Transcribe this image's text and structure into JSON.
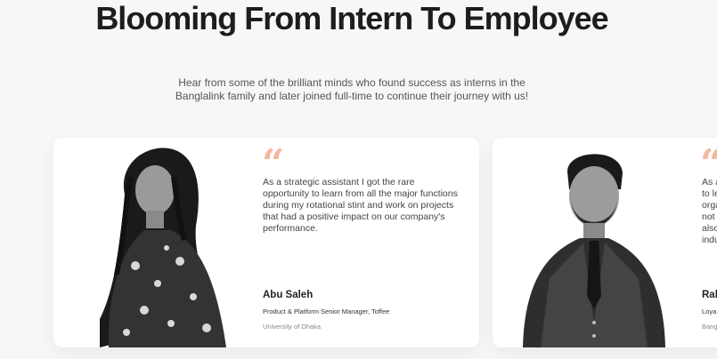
{
  "header": {
    "title": "Blooming From Intern To Employee",
    "subtitle_line1": "Hear from some of the brilliant minds who found success as interns in the",
    "subtitle_line2": "Banglalink family and later joined full-time to continue their journey with us!"
  },
  "testimonials": [
    {
      "quote_mark": "“",
      "quote": "As a strategic assistant I got the rare opportunity to learn from all the major functions during my rotational stint and work on projects that had a positive impact on our company's performance.",
      "name": "Abu Saleh",
      "role": "Product & Platform Senior Manager, Toffee",
      "school": "University of Dhaka"
    },
    {
      "quote_mark": "“",
      "quote_lines": [
        "As a",
        "to le",
        "orga",
        "not",
        "also",
        "indu"
      ],
      "name": "Rab",
      "role": "Loya",
      "school": "Bang"
    }
  ],
  "colors": {
    "accent_quote": "#f2b8a0",
    "card_bg": "#ffffff",
    "page_bg": "#f7f7f7"
  }
}
